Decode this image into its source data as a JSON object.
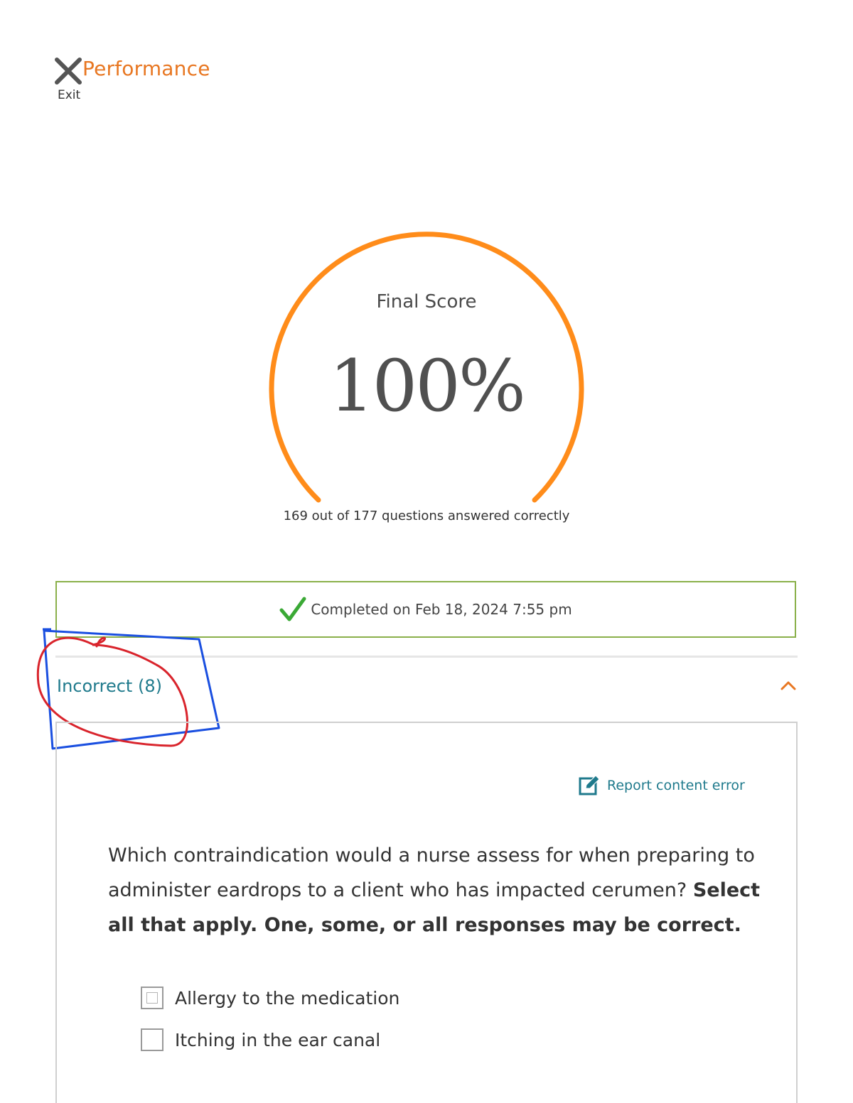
{
  "header": {
    "title": "Performance",
    "exit_label": "Exit"
  },
  "score": {
    "title": "Final Score",
    "value": "100%",
    "summary": "169 out of 177 questions answered correctly",
    "accent_color": "#ff8c1a"
  },
  "completion": {
    "text": "Completed on Feb 18, 2024 7:55 pm",
    "border_color": "#8ab04a",
    "check_color": "#3aa935"
  },
  "section": {
    "title": "Incorrect (8)",
    "expanded": true
  },
  "question": {
    "report_label": "Report content error",
    "text_plain": "Which contraindication would a nurse assess for when preparing to administer eardrops to a client who has impacted cerumen? ",
    "text_bold": "Select all that apply. One, some, or all responses may be correct.",
    "options": [
      {
        "label": "Allergy to the medication",
        "checked": false
      },
      {
        "label": "Itching in the ear canal",
        "checked": false
      }
    ]
  },
  "colors": {
    "brand": "#e87722",
    "link": "#1f7a8c"
  }
}
